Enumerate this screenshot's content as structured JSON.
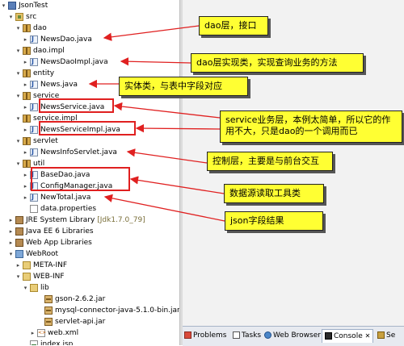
{
  "tree": {
    "rows": [
      {
        "label": "JsonTest"
      },
      {
        "label": "src"
      },
      {
        "label": "dao"
      },
      {
        "label": "NewsDao.java"
      },
      {
        "label": "dao.impl"
      },
      {
        "label": "NewsDaoImpl.java"
      },
      {
        "label": "entity"
      },
      {
        "label": "News.java"
      },
      {
        "label": "service"
      },
      {
        "label": "NewsService.java"
      },
      {
        "label": "service.impl"
      },
      {
        "label": "NewsServiceImpl.java"
      },
      {
        "label": "servlet"
      },
      {
        "label": "NewsInfoServlet.java"
      },
      {
        "label": "util"
      },
      {
        "label": "BaseDao.java"
      },
      {
        "label": "ConfigManager.java"
      },
      {
        "label": "NewTotal.java"
      },
      {
        "label": "data.properties"
      },
      {
        "label": "JRE System Library",
        "suffix": "[Jdk1.7.0_79]"
      },
      {
        "label": "Java EE 6 Libraries"
      },
      {
        "label": "Web App Libraries"
      },
      {
        "label": "WebRoot"
      },
      {
        "label": "META-INF"
      },
      {
        "label": "WEB-INF"
      },
      {
        "label": "lib"
      },
      {
        "label": "gson-2.6.2.jar"
      },
      {
        "label": "mysql-connector-java-5.1.0-bin.jar"
      },
      {
        "label": "servlet-api.jar"
      },
      {
        "label": "web.xml"
      },
      {
        "label": "index.jsp"
      }
    ]
  },
  "callouts": {
    "dao": "dao层，接口",
    "daoimpl": "dao层实现类，实现查询业务的方法",
    "entity": "实体类，与表中字段对应",
    "service": "service业务层，本例太简单，所以它的作用不大，只是dao的一个调用而已",
    "servlet": "控制层，主要是与前台交互",
    "util": "数据源读取工具类",
    "json": "json字段结果"
  },
  "tabs": {
    "problems": "Problems",
    "tasks": "Tasks",
    "webbrowser": "Web Browser",
    "console": "Console",
    "more": "Se"
  },
  "colors": {
    "callout_bg": "#ffff33",
    "highlight": "#e02020",
    "arrow": "#e02020"
  }
}
